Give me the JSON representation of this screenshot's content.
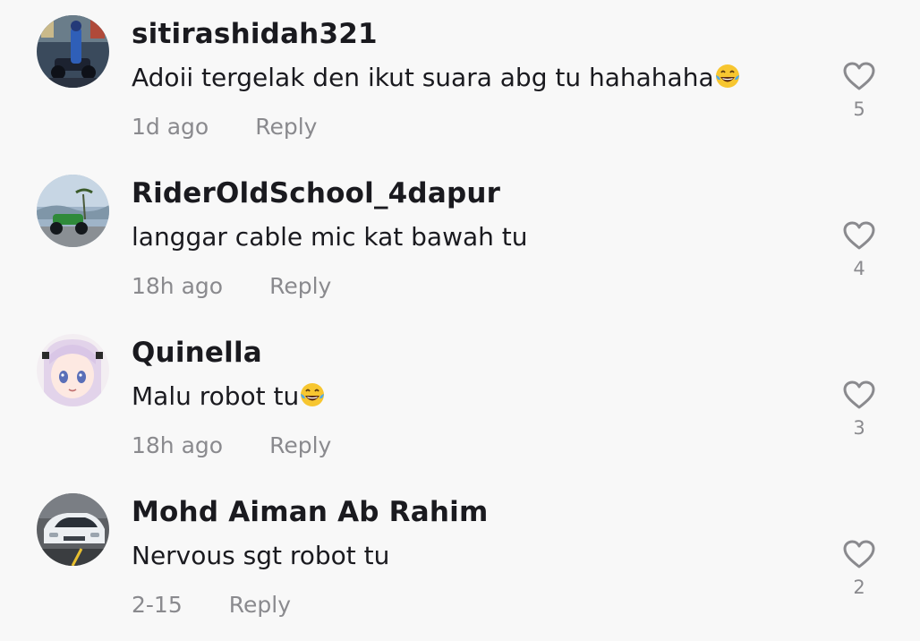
{
  "comments": [
    {
      "username": "sitirashidah321",
      "text": "Adoii tergelak den ikut suara abg tu hahahaha",
      "emoji": "laughing-tears-emoji",
      "time": "1d ago",
      "reply_label": "Reply",
      "likes": "5"
    },
    {
      "username": "RiderOldSchool_4dapur",
      "text": "langgar cable mic kat bawah tu",
      "time": "18h ago",
      "reply_label": "Reply",
      "likes": "4"
    },
    {
      "username": "Quinella",
      "text": "Malu robot tu",
      "emoji": "laughing-tears-emoji",
      "time": "18h ago",
      "reply_label": "Reply",
      "likes": "3"
    },
    {
      "username": "Mohd Aiman Ab Rahim",
      "text": "Nervous sgt robot tu",
      "time": "2-15",
      "reply_label": "Reply",
      "likes": "2"
    }
  ],
  "icons": {
    "like": "heart-outline-icon"
  },
  "colors": {
    "background": "#f8f8f8",
    "username": "#1a1a1f",
    "secondary": "#8a8a8e"
  }
}
